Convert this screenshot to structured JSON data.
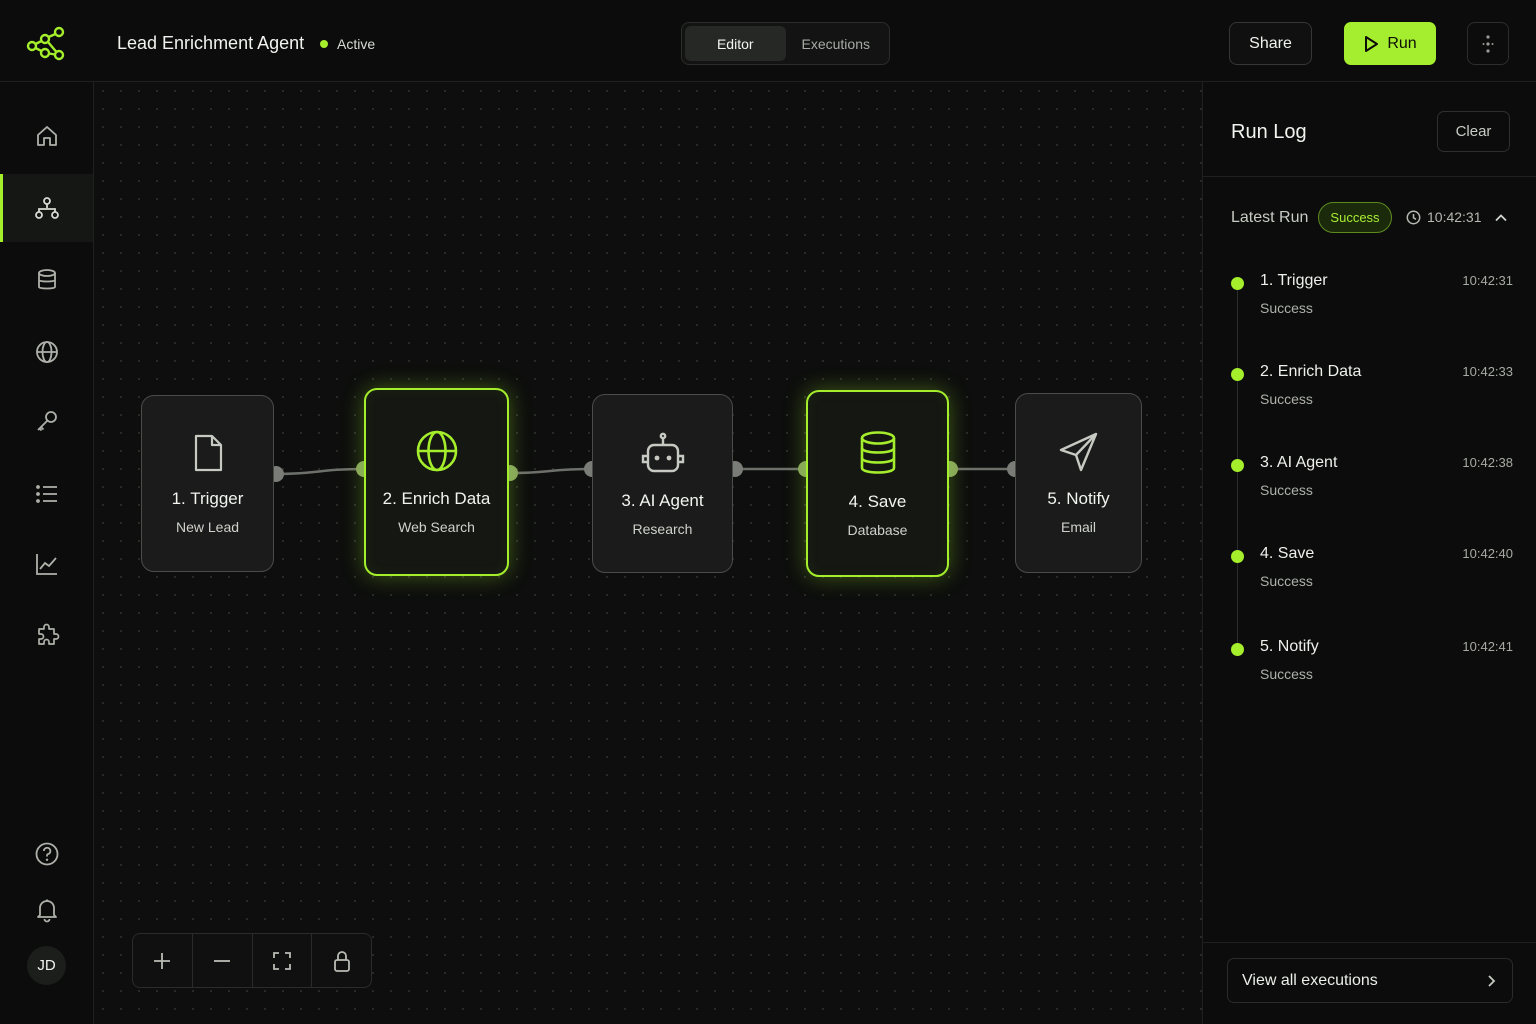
{
  "header": {
    "workflow_name": "Lead Enrichment Agent",
    "status": "Active",
    "tabs": [
      {
        "label": "Editor",
        "active": true
      },
      {
        "label": "Executions",
        "active": false
      }
    ],
    "share_label": "Share",
    "run_label": "Run"
  },
  "sidebar": {
    "items": [
      {
        "icon": "home-icon",
        "active": false
      },
      {
        "icon": "workflow-icon",
        "active": true
      },
      {
        "icon": "database-icon",
        "active": false
      },
      {
        "icon": "globe-icon",
        "active": false
      },
      {
        "icon": "key-icon",
        "active": false
      },
      {
        "icon": "list-icon",
        "active": false
      },
      {
        "icon": "chart-icon",
        "active": false
      },
      {
        "icon": "puzzle-icon",
        "active": false
      }
    ],
    "bottom": [
      {
        "icon": "help-icon"
      },
      {
        "icon": "bell-icon"
      }
    ],
    "avatar_initials": "JD"
  },
  "canvas": {
    "nodes": [
      {
        "title": "1. Trigger",
        "subtitle": "New Lead",
        "icon": "file-icon",
        "highlighted": false
      },
      {
        "title": "2. Enrich Data",
        "subtitle": "Web Search",
        "icon": "globe-icon",
        "highlighted": true
      },
      {
        "title": "3. AI Agent",
        "subtitle": "Research",
        "icon": "robot-icon",
        "highlighted": false
      },
      {
        "title": "4. Save",
        "subtitle": "Database",
        "icon": "database-icon",
        "highlighted": true
      },
      {
        "title": "5. Notify",
        "subtitle": "Email",
        "icon": "send-icon",
        "highlighted": false
      }
    ],
    "zoom_controls": [
      "plus-icon",
      "minus-icon",
      "fit-view-icon",
      "lock-icon"
    ]
  },
  "run_log": {
    "title": "Run Log",
    "clear_label": "Clear",
    "latest_label": "Latest Run",
    "latest_status": "Success",
    "latest_time": "10:42:31",
    "entries": [
      {
        "title": "1. Trigger",
        "status": "Success",
        "time": "10:42:31"
      },
      {
        "title": "2. Enrich Data",
        "status": "Success",
        "time": "10:42:33"
      },
      {
        "title": "3. AI Agent",
        "status": "Success",
        "time": "10:42:38"
      },
      {
        "title": "4. Save",
        "status": "Success",
        "time": "10:42:40"
      },
      {
        "title": "5. Notify",
        "status": "Success",
        "time": "10:42:41"
      }
    ],
    "view_all_label": "View all executions"
  },
  "colors": {
    "accent": "#a4ee2c",
    "background": "#0b0c0b",
    "node_border": "#4a4c48"
  }
}
